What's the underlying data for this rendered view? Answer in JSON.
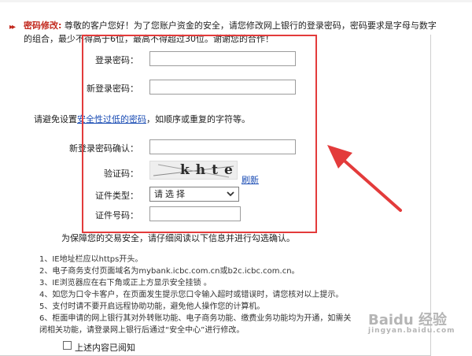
{
  "intro": {
    "label": "密码修改:",
    "line1": "尊敬的客户您好！为了您账户资金的安全，请您修改网上银行的登录密码，密码要求是字母与数字",
    "line2": "的组合，最少不得高于6位，最高不得超过30位。谢谢您的合作！"
  },
  "form": {
    "login_password_label": "登录密码：",
    "new_login_password_label": "新登录密码：",
    "hint_prefix": "请避免设置",
    "hint_link": "安全性过低的密码",
    "hint_suffix": "，如顺序或重复的字符等。",
    "confirm_label": "新登录密码确认：",
    "captcha_label": "验证码：",
    "captcha_text": "khte",
    "refresh_label": "刷新",
    "cert_type_label": "证件类型：",
    "cert_type_selected": "请选择",
    "cert_number_label": "证件号码："
  },
  "notice": {
    "title": "为保障您的交易安全，请仔细阅读以下信息并进行勾选确认。",
    "items": [
      "1、IE地址栏应以https开头。",
      "2、电子商务支付页面域名为mybank.icbc.com.cn或b2c.icbc.com.cn。",
      "3、IE浏览器应在右下角或正上方显示安全挂锁 。",
      "4、如您为口令卡客户，在页面发生提示您口令输入超时或错误时，请您核对以上提示。",
      "5、支付时请不要开启远程协助功能，避免他人操作您的计算机。",
      "6、柜面申请的网上银行其对外转账功能、电子商务功能、缴费业务功能均为开通，如需关",
      "闭相关功能，请登录网上银行后通过“安全中心”进行修改。"
    ],
    "agree_label": "上述内容已阅知"
  },
  "watermark": {
    "text": "Baidu 经验",
    "sub": "jingyan.baidu.com"
  },
  "colors": {
    "accent_red": "#e33b3b",
    "link_blue": "#1a4cb4"
  }
}
